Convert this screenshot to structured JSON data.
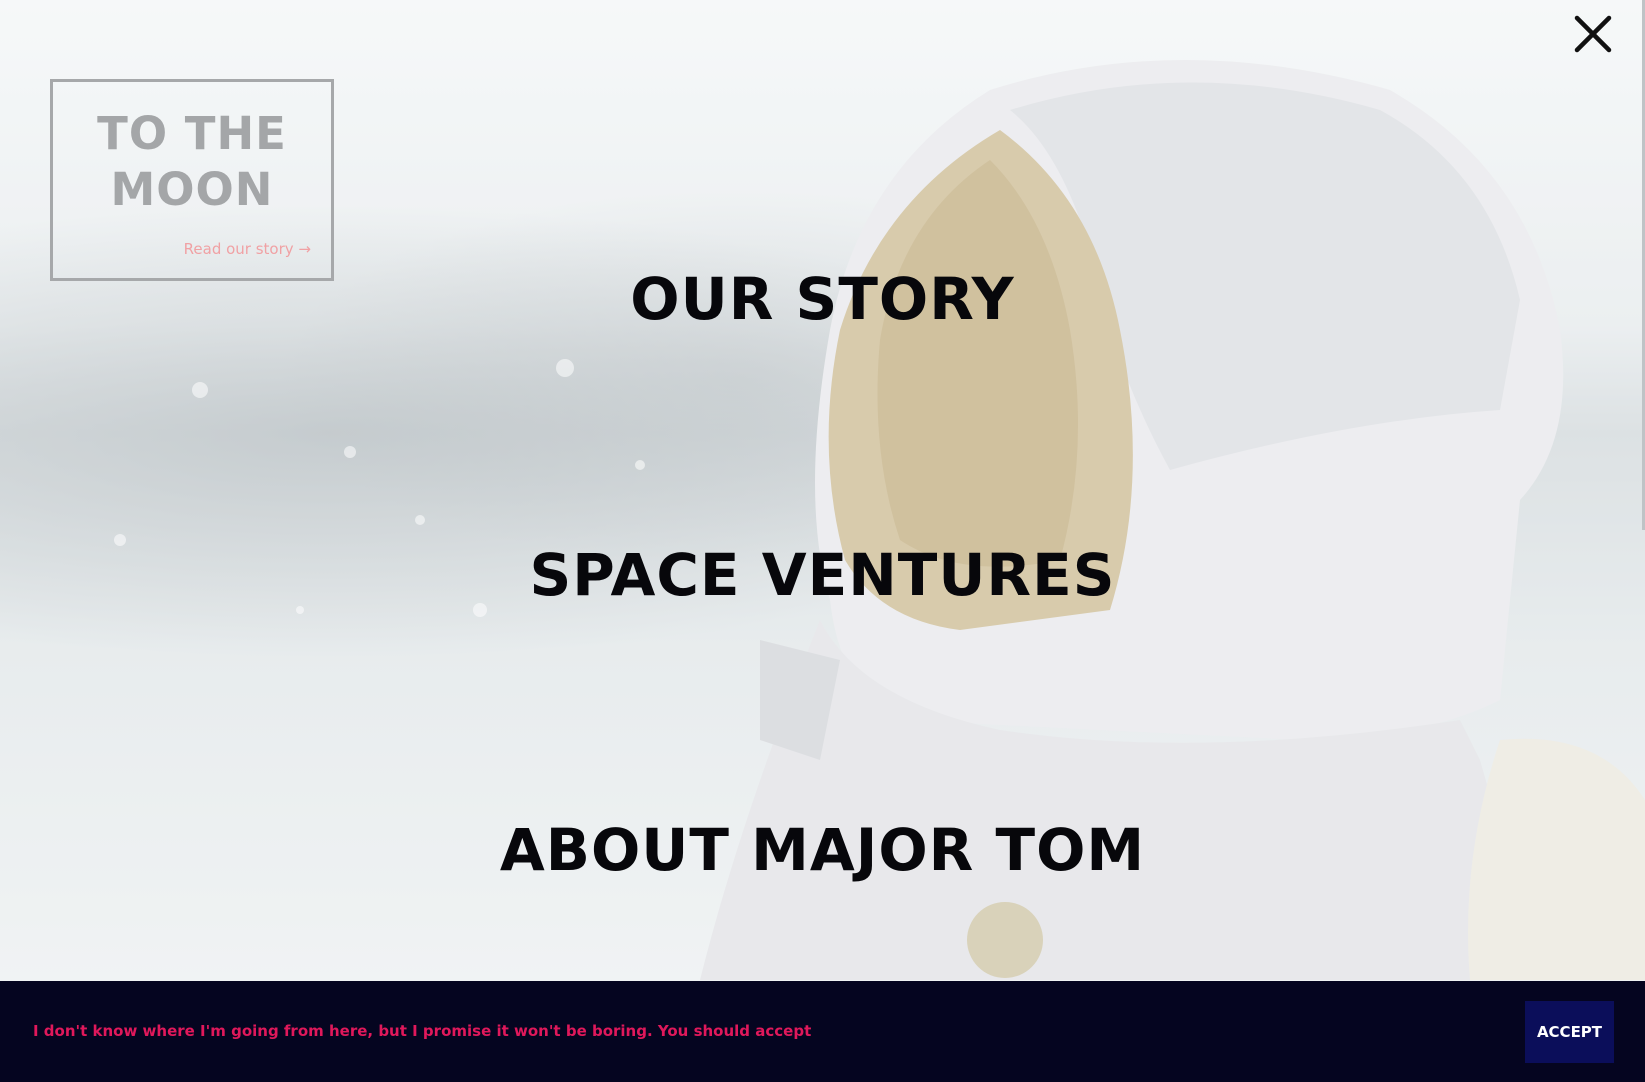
{
  "close": {
    "icon": "close-icon"
  },
  "promo": {
    "title_line1": "TO THE",
    "title_line2": "MOON",
    "link": "Read our story →"
  },
  "nav": {
    "items": [
      {
        "label": "OUR STORY"
      },
      {
        "label": "SPACE VENTURES"
      },
      {
        "label": "ABOUT MAJOR TOM"
      }
    ]
  },
  "cookie": {
    "message": "I don't know where I'm going from here, but I promise it won't be boring. You should accept",
    "accept_label": "ACCEPT"
  },
  "colors": {
    "nav_text": "#07070b",
    "cookie_bg": "#050520",
    "cookie_text": "#e0185b",
    "accept_bg": "#0b0e5a",
    "promo_link": "#f0a1a4"
  }
}
